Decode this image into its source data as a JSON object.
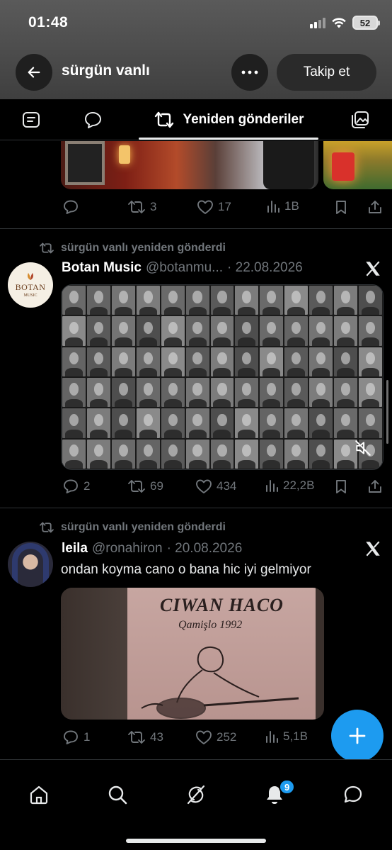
{
  "status_bar": {
    "time": "01:48",
    "battery": "52",
    "icons": [
      "cellular-signal-icon",
      "wifi-icon",
      "battery-icon"
    ]
  },
  "header": {
    "profile_name": "sürgün vanlı",
    "follow_label": "Takip et",
    "icons": [
      "back-arrow-icon",
      "more-icon"
    ]
  },
  "tabs": {
    "active_label": "Yeniden gönderiler",
    "icons": [
      "posts-icon",
      "replies-icon",
      "reposts-icon",
      "media-icon"
    ]
  },
  "posts": [
    {
      "partial": true,
      "stats": {
        "replies": "",
        "reposts": "3",
        "likes": "17",
        "views": "1B"
      }
    },
    {
      "repost_label": "sürgün vanlı yeniden gönderdi",
      "author_name": "Botan Music",
      "handle": "@botanmu...",
      "date": "· 22.08.2026",
      "avatar_text": "BOTAN",
      "avatar_subtext": "MUSIC",
      "stats": {
        "replies": "2",
        "reposts": "69",
        "likes": "434",
        "views": "22,2B"
      }
    },
    {
      "repost_label": "sürgün vanlı yeniden gönderdi",
      "author_name": "leila",
      "handle": "@ronahiron",
      "date": "· 20.08.2026",
      "text": "ondan koyma cano o bana hic iyi gelmiyor",
      "media_title": "CIWAN HACO",
      "media_subtitle": "Qamişlo 1992",
      "stats": {
        "replies": "1",
        "reposts": "43",
        "likes": "252",
        "views": "5,1B"
      }
    }
  ],
  "bottom_nav": {
    "items": [
      "home-icon",
      "search-icon",
      "grok-icon",
      "notifications-icon",
      "messages-icon"
    ],
    "notification_count": "9"
  },
  "colors": {
    "accent": "#1d9bf0",
    "background": "#000000",
    "muted_text": "#71767b",
    "text": "#e7e9ea"
  }
}
